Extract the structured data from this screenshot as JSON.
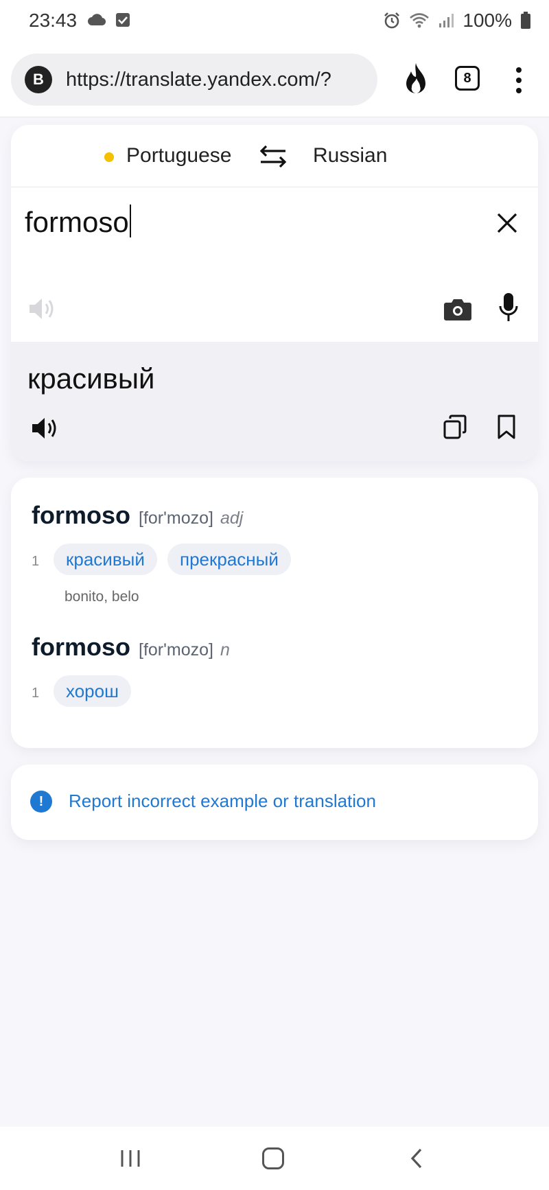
{
  "status_bar": {
    "time": "23:43",
    "battery": "100%"
  },
  "browser": {
    "site_badge": "B",
    "url": "https://translate.yandex.com/?",
    "tab_count": "8"
  },
  "translator": {
    "source_language": "Portuguese",
    "target_language": "Russian",
    "input_text": "formoso",
    "output_text": "красивый",
    "source_dot_color": "#f5c000"
  },
  "dictionary": {
    "entries": [
      {
        "word": "formoso",
        "transcription": "[for'mozo]",
        "pos": "adj",
        "senses": [
          {
            "number": "1",
            "translations": [
              "красивый",
              "прекрасный"
            ],
            "synonyms": "bonito, belo"
          }
        ]
      },
      {
        "word": "formoso",
        "transcription": "[for'mozo]",
        "pos": "n",
        "senses": [
          {
            "number": "1",
            "translations": [
              "хорош"
            ]
          }
        ]
      }
    ]
  },
  "report": {
    "icon_text": "!",
    "link_text": "Report incorrect example or translation"
  },
  "colors": {
    "accent": "#1f78d1",
    "chip_bg": "#eef0f6",
    "output_bg": "#f0f0f5"
  }
}
